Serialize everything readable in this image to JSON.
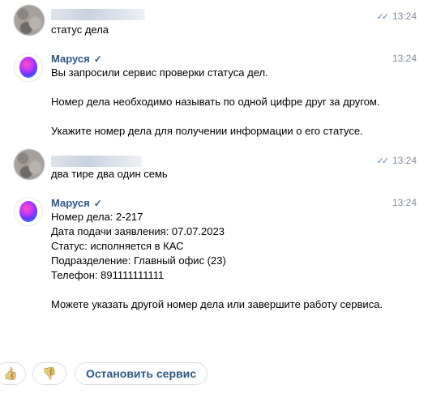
{
  "messages": [
    {
      "time": "13:24",
      "read_icon": "double-check-icon",
      "lines": [
        "статус дела"
      ]
    },
    {
      "sender": "Маруся",
      "verified_icon": "verified-check-icon",
      "time": "13:24",
      "lines": [
        "Вы запросили сервис проверки статуса дел.",
        "",
        "Номер дела необходимо называть по одной цифре друг за другом.",
        "",
        "Укажите номер дела для получении информации о его статусе."
      ]
    },
    {
      "time": "13:24",
      "read_icon": "double-check-icon",
      "lines": [
        "два тире два один семь"
      ]
    },
    {
      "sender": "Маруся",
      "verified_icon": "verified-check-icon",
      "time": "13:24",
      "lines": [
        "Номер дела: 2-217",
        "Дата подачи заявления: 07.07.2023",
        "Статус: исполняется в КАС",
        "Подразделение: Главный офис (23)",
        "Телефон: 891111111111",
        "",
        "Можете указать другой номер дела или завершите работу сервиса."
      ]
    }
  ],
  "actions": {
    "like_icon": "thumbs-up-icon",
    "dislike_icon": "thumbs-down-icon",
    "stop_label": "Остановить сервис"
  },
  "colors": {
    "link": "#2a5885",
    "meta": "#818c99",
    "read_check": "#5181b8"
  }
}
